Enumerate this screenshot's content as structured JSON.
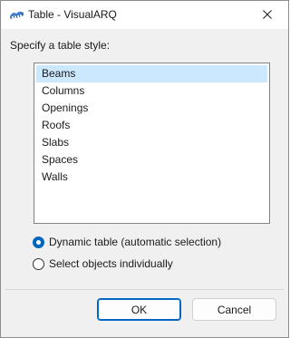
{
  "window": {
    "title": "Table - VisualARQ",
    "app_icon": "visualarq-icon",
    "close_icon": "close-icon"
  },
  "prompt": "Specify a table style:",
  "list": {
    "items": [
      "Beams",
      "Columns",
      "Openings",
      "Roofs",
      "Slabs",
      "Spaces",
      "Walls"
    ],
    "selected": "Beams"
  },
  "options": {
    "dynamic_label": "Dynamic table (automatic selection)",
    "individual_label": "Select objects individually",
    "checked": "dynamic"
  },
  "buttons": {
    "ok_label": "OK",
    "cancel_label": "Cancel"
  },
  "colors": {
    "accent": "#0067c0",
    "selection": "#cce8ff",
    "icon_blue": "#3f7fcf"
  }
}
